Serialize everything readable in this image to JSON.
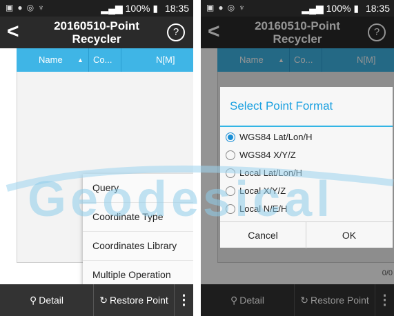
{
  "status_bar": {
    "battery": "100%",
    "time": "18:35"
  },
  "titlebar": {
    "title": "20160510-Point\nRecycler"
  },
  "table": {
    "columns": [
      "Name",
      "Co...",
      "N[M]"
    ],
    "count": "0/0"
  },
  "menu": {
    "items": [
      "Query",
      "Coordinate Type",
      "Coordinates Library",
      "Multiple Operation"
    ]
  },
  "bottom_bar": {
    "detail_label": "Detail",
    "restore_label": "Restore Point"
  },
  "dialog": {
    "title": "Select Point Format",
    "options": [
      "WGS84 Lat/Lon/H",
      "WGS84 X/Y/Z",
      "Local Lat/Lon/H",
      "Local X/Y/Z",
      "Local N/E/H"
    ],
    "selected_index": 0,
    "cancel_label": "Cancel",
    "ok_label": "OK"
  },
  "watermark": {
    "text": "Geodesical"
  },
  "colors": {
    "accent": "#3fb5e6",
    "dark_bar": "#2a2a2a",
    "radio": "#1a8fd6"
  }
}
